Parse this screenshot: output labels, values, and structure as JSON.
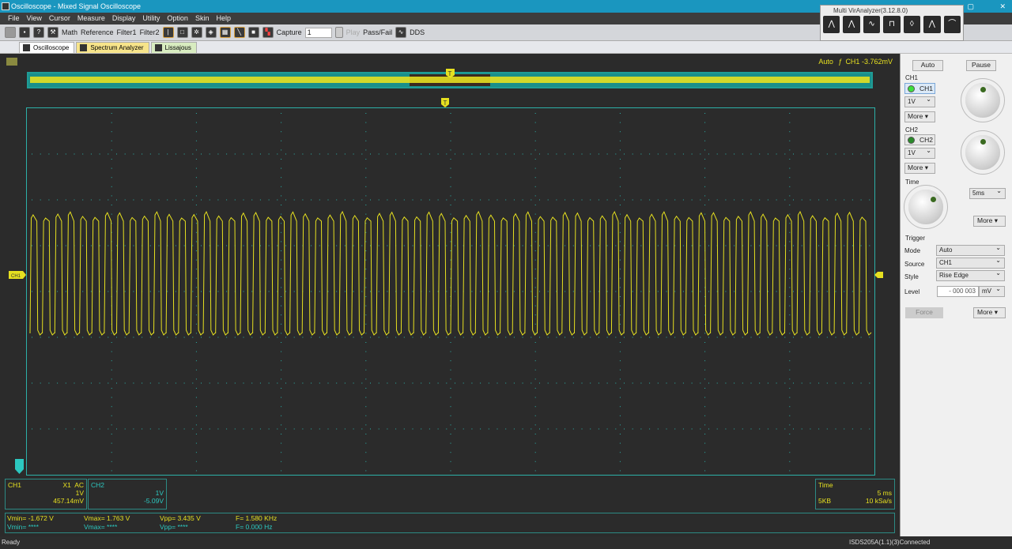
{
  "window": {
    "title": "Oscilloscope - Mixed Signal Oscilloscope",
    "controls": [
      "▢",
      "✕"
    ]
  },
  "menu": [
    "File",
    "View",
    "Cursor",
    "Measure",
    "Display",
    "Utility",
    "Option",
    "Skin",
    "Help"
  ],
  "toolbar": {
    "math": "Math",
    "reference": "Reference",
    "filter1": "Filter1",
    "filter2": "Filter2",
    "capture": "Capture",
    "capture_value": "1",
    "play": "Play",
    "passfail": "Pass/Fail",
    "dds": "DDS"
  },
  "tabs": [
    "Oscilloscope",
    "Spectrum Analyzer",
    "Lissajous"
  ],
  "vir": {
    "title": "Multi VirAnalyzer(3.12.8.0)"
  },
  "scope": {
    "trigger_status": "Auto",
    "trigger_ch": "CH1",
    "trigger_level": "-3.762mV",
    "ch1_marker": "CH1",
    "trigger_marker": "T"
  },
  "ch1": {
    "label": "CH1",
    "probe": "X1",
    "coupling": "AC",
    "scale": "1V",
    "offset": "457.14mV"
  },
  "ch2": {
    "label": "CH2",
    "scale": "1V",
    "offset": "-5.09V"
  },
  "time": {
    "label": "Time",
    "scale": "5 ms",
    "depth": "5KB",
    "rate": "10 kSa/s"
  },
  "meas": {
    "ch1": {
      "vmin": "Vmin= -1.672 V",
      "vmax": "Vmax= 1.763 V",
      "vpp": "Vpp= 3.435 V",
      "f": "F= 1.580 KHz"
    },
    "ch2": {
      "vmin": "Vmin= ****",
      "vmax": "Vmax= ****",
      "vpp": "Vpp= ****",
      "f": "F= 0.000 Hz"
    }
  },
  "panel": {
    "auto": "Auto",
    "pause": "Pause",
    "ch1_group": "CH1",
    "ch1_btn": "CH1",
    "ch1_volt": "1V",
    "more": "More",
    "ch2_group": "CH2",
    "ch2_btn": "CH2",
    "ch2_volt": "1V",
    "time_group": "Time",
    "time_sel": "5ms",
    "trigger_group": "Trigger",
    "mode_label": "Mode",
    "mode": "Auto",
    "source_label": "Source",
    "source": "CH1",
    "style_label": "Style",
    "style": "Rise Edge",
    "level_label": "Level",
    "level": "- 000 003",
    "level_unit": "mV",
    "force": "Force"
  },
  "status": {
    "left": "Ready",
    "right": "ISDS205A(1.1)(3)Connected"
  },
  "colors": {
    "ch1": "#e6e020",
    "ch2": "#2cc8c0",
    "grid": "#2cb0a8"
  }
}
